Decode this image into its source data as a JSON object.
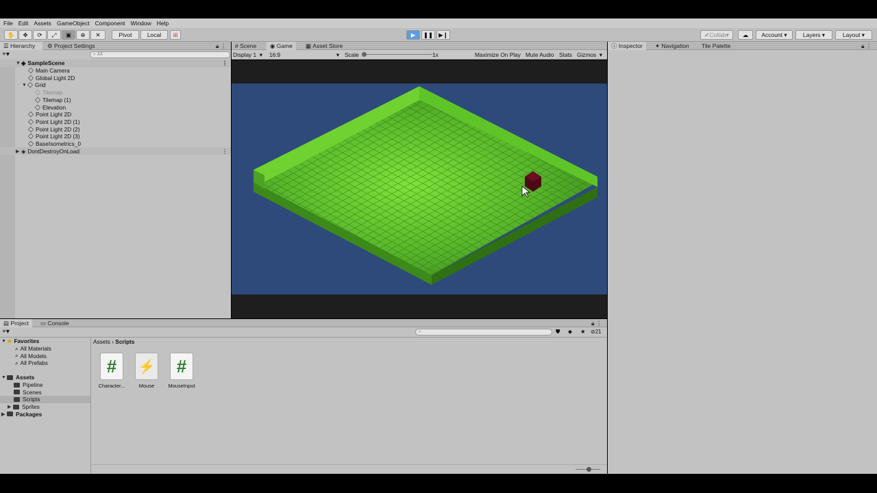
{
  "menu": [
    "File",
    "Edit",
    "Assets",
    "GameObject",
    "Component",
    "Window",
    "Help"
  ],
  "toolbar": {
    "pivot": "Pivot",
    "local": "Local",
    "collab": "Collab",
    "account": "Account",
    "layers": "Layers",
    "layout": "Layout"
  },
  "hierarchy": {
    "tab": "Hierarchy",
    "tab2": "Project Settings",
    "search_placeholder": "All",
    "items": [
      {
        "label": "SampleScene"
      },
      {
        "label": "Main Camera"
      },
      {
        "label": "Global Light 2D"
      },
      {
        "label": "Grid"
      },
      {
        "label": "Tilemap"
      },
      {
        "label": "Tilemap (1)"
      },
      {
        "label": "Elevation"
      },
      {
        "label": "Point Light 2D"
      },
      {
        "label": "Point Light 2D (1)"
      },
      {
        "label": "Point Light 2D (2)"
      },
      {
        "label": "Point Light 2D (3)"
      },
      {
        "label": "BaseIsometrics_0"
      },
      {
        "label": "DontDestroyOnLoad"
      }
    ]
  },
  "game": {
    "tabs": [
      "Scene",
      "Game",
      "Asset Store"
    ],
    "display": "Display 1",
    "aspect": "16:9",
    "scale_label": "Scale",
    "scale_value": "1x",
    "maximize": "Maximize On Play",
    "mute": "Mute Audio",
    "stats": "Stats",
    "gizmos": "Gizmos"
  },
  "inspector": {
    "tabs": [
      "Inspector",
      "Navigation",
      "Tile Palette"
    ]
  },
  "project": {
    "tabs": [
      "Project",
      "Console"
    ],
    "breadcrumb_root": "Assets",
    "breadcrumb_leaf": "Scripts",
    "hidden_count": "21",
    "favorites": "Favorites",
    "fav_items": [
      "All Materials",
      "All Models",
      "All Prefabs"
    ],
    "assets": "Assets",
    "asset_folders": [
      "Pipeline",
      "Scenes",
      "Scripts",
      "Sprites"
    ],
    "packages": "Packages",
    "files": [
      {
        "label": "Character...",
        "icon": "csharp-script-icon"
      },
      {
        "label": "Mouse",
        "icon": "input-actions-icon"
      },
      {
        "label": "MouseInput",
        "icon": "csharp-script-icon"
      }
    ]
  }
}
